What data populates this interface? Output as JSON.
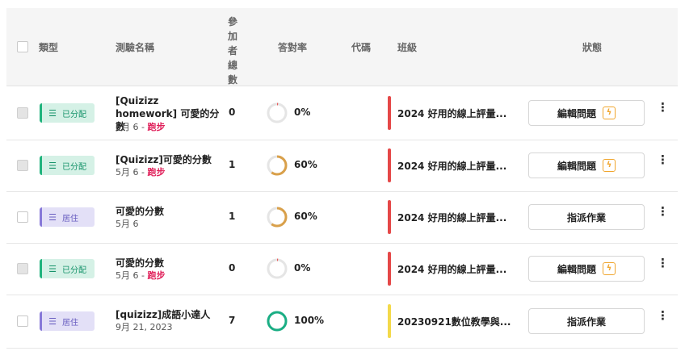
{
  "header": {
    "type_label": "類型",
    "name_label": "測驗名稱",
    "participants_label": [
      "參",
      "加",
      "者",
      "總",
      "數"
    ],
    "accuracy_label": "答對率",
    "code_label": "代碼",
    "class_label": "班級",
    "status_label": "狀態"
  },
  "rows": [
    {
      "type": "已分配",
      "type_kind": "assigned",
      "checkbox": "gray",
      "name": "[Quizizz homework] 可愛的分數",
      "date": "5月 6 - ",
      "mode": "跑步",
      "count": "0",
      "accuracy": 0,
      "accuracy_label": "0%",
      "class_name": "2024 好用的線上評量...",
      "class_color": "#e54848",
      "action": "編輯問題",
      "action_bolt": true
    },
    {
      "type": "已分配",
      "type_kind": "assigned",
      "checkbox": "gray",
      "name": "[Quizizz]可愛的分數",
      "date": "5月 6 - ",
      "mode": "跑步",
      "count": "1",
      "accuracy": 60,
      "accuracy_label": "60%",
      "class_name": "2024 好用的線上評量...",
      "class_color": "#e54848",
      "action": "編輯問題",
      "action_bolt": true
    },
    {
      "type": "居住",
      "type_kind": "home",
      "checkbox": "white",
      "name": "可愛的分數",
      "date": "5月 6",
      "mode": "",
      "count": "1",
      "accuracy": 60,
      "accuracy_label": "60%",
      "class_name": "2024 好用的線上評量...",
      "class_color": "#e54848",
      "action": "指派作業",
      "action_bolt": false
    },
    {
      "type": "已分配",
      "type_kind": "assigned",
      "checkbox": "gray",
      "name": "可愛的分數",
      "date": "5月 6 - ",
      "mode": "跑步",
      "count": "0",
      "accuracy": 0,
      "accuracy_label": "0%",
      "class_name": "2024 好用的線上評量...",
      "class_color": "#e54848",
      "action": "編輯問題",
      "action_bolt": true
    },
    {
      "type": "居住",
      "type_kind": "home",
      "checkbox": "white",
      "name": "[quizizz]成語小達人",
      "date": "9月 21, 2023",
      "mode": "",
      "count": "7",
      "accuracy": 100,
      "accuracy_label": "100%",
      "class_name": "20230921數位教學與...",
      "class_color": "#f3d94a",
      "action": "指派作業",
      "action_bolt": false
    }
  ],
  "colors": {
    "ring_low": "#d9a04a",
    "ring_full": "#1aae84",
    "ring_zero": "#e85a5a",
    "ring_track": "#e5e5e5"
  },
  "icons": {
    "type": "checklist-icon",
    "bolt": "lightning-icon",
    "more": "more-vertical-icon"
  }
}
